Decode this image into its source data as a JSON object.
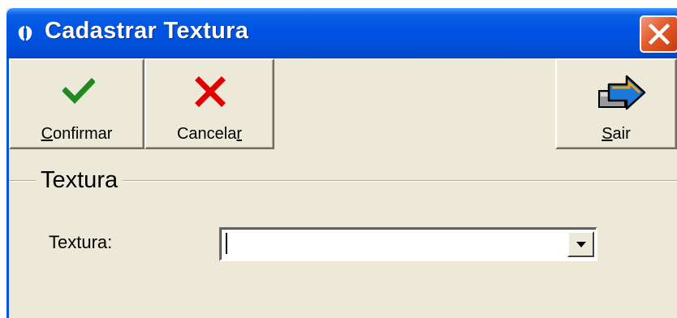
{
  "window": {
    "title": "Cadastrar Textura"
  },
  "toolbar": {
    "confirm": {
      "label": "Confirmar",
      "accel": "C",
      "icon": "checkmark-icon"
    },
    "cancel": {
      "label": "Cancelar",
      "accel": "r",
      "icon": "x-icon"
    },
    "exit": {
      "label": "Sair",
      "accel": "S",
      "icon": "exit-arrow-icon"
    }
  },
  "group": {
    "title": "Textura"
  },
  "form": {
    "textura_label": "Textura:",
    "textura_value": ""
  },
  "colors": {
    "titlebar": "#0054e3",
    "face": "#ece9d8",
    "confirm_icon": "#1f8a1f",
    "cancel_icon": "#e00000",
    "close_button": "#e35a2a"
  }
}
